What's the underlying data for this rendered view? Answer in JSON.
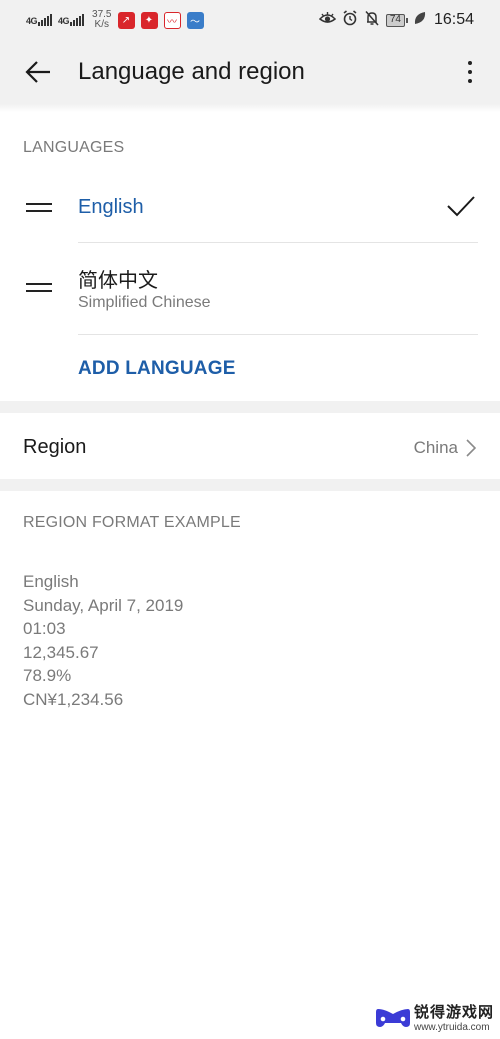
{
  "status_bar": {
    "signal1": "4G",
    "signal2": "4G",
    "speed_value": "37.5",
    "speed_unit": "K/s",
    "battery": "74",
    "time": "16:54",
    "icons": [
      "eye-icon",
      "alarm-icon",
      "bell-off-icon",
      "battery-icon",
      "leaf-icon"
    ]
  },
  "app_bar": {
    "title": "Language and region",
    "back_icon": "arrow-left-icon",
    "more_icon": "more-vertical-icon"
  },
  "languages": {
    "header": "LANGUAGES",
    "items": [
      {
        "name": "English",
        "subtitle": "",
        "selected": true
      },
      {
        "name": "简体中文",
        "subtitle": "Simplified Chinese",
        "selected": false
      }
    ],
    "add_label": "ADD LANGUAGE"
  },
  "region": {
    "label": "Region",
    "value": "China"
  },
  "format_example": {
    "header": "REGION FORMAT EXAMPLE",
    "lines": [
      "English",
      "Sunday, April 7, 2019",
      "01:03",
      "12,345.67",
      "78.9%",
      "CN¥1,234.56"
    ]
  },
  "watermark": {
    "title": "锐得游戏网",
    "url": "www.ytruida.com"
  },
  "colors": {
    "accent": "#1e5ea8",
    "secondary_text": "#7a7a7a",
    "background_gray": "#f1f1f1"
  }
}
